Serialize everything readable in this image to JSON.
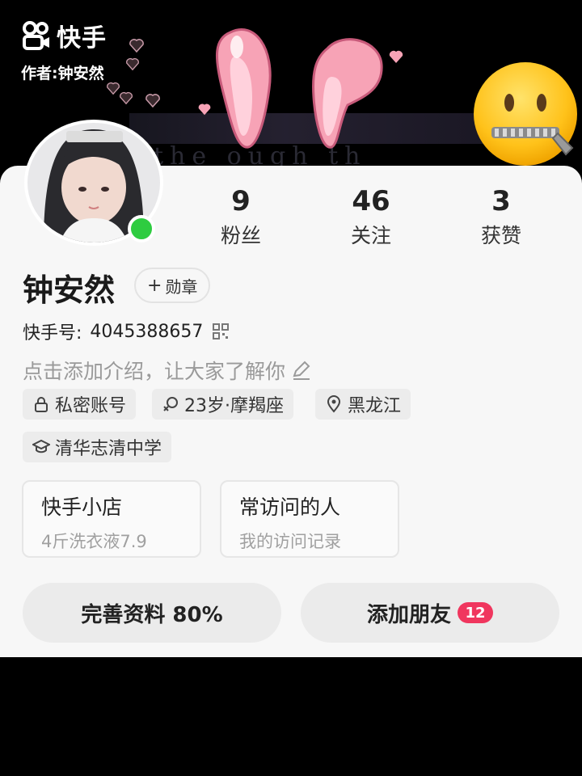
{
  "watermark": {
    "app_name": "快手",
    "author": "作者:钟安然"
  },
  "banner": {
    "strip_text": "the    ough   th"
  },
  "profile": {
    "stats": [
      {
        "value": "9",
        "label": "粉丝"
      },
      {
        "value": "46",
        "label": "关注"
      },
      {
        "value": "3",
        "label": "获赞"
      }
    ],
    "name": "钟安然",
    "badge_button": "勋章",
    "kuaishou_id_label": "快手号:",
    "kuaishou_id": "4045388657",
    "intro_placeholder": "点击添加介绍，让大家了解你",
    "tags": [
      {
        "icon": "lock-icon",
        "label": "私密账号"
      },
      {
        "icon": "gender-icon",
        "label": "23岁·摩羯座"
      },
      {
        "icon": "location-pin-icon",
        "label": "黑龙江"
      },
      {
        "icon": "graduation-cap-icon",
        "label": "清华志清中学"
      }
    ]
  },
  "shortcuts": [
    {
      "title": "快手小店",
      "subtitle": "4斤洗衣液7.9"
    },
    {
      "title": "常访问的人",
      "subtitle": "我的访问记录"
    }
  ],
  "actions": {
    "complete_profile": "完善资料 80%",
    "add_friends": "添加朋友",
    "add_friends_count": "12"
  },
  "colors": {
    "card_bg": "#f7f7f7",
    "online": "#2ecc40",
    "badge": "#f0365e",
    "ear_pink": "#f7a3b6"
  }
}
